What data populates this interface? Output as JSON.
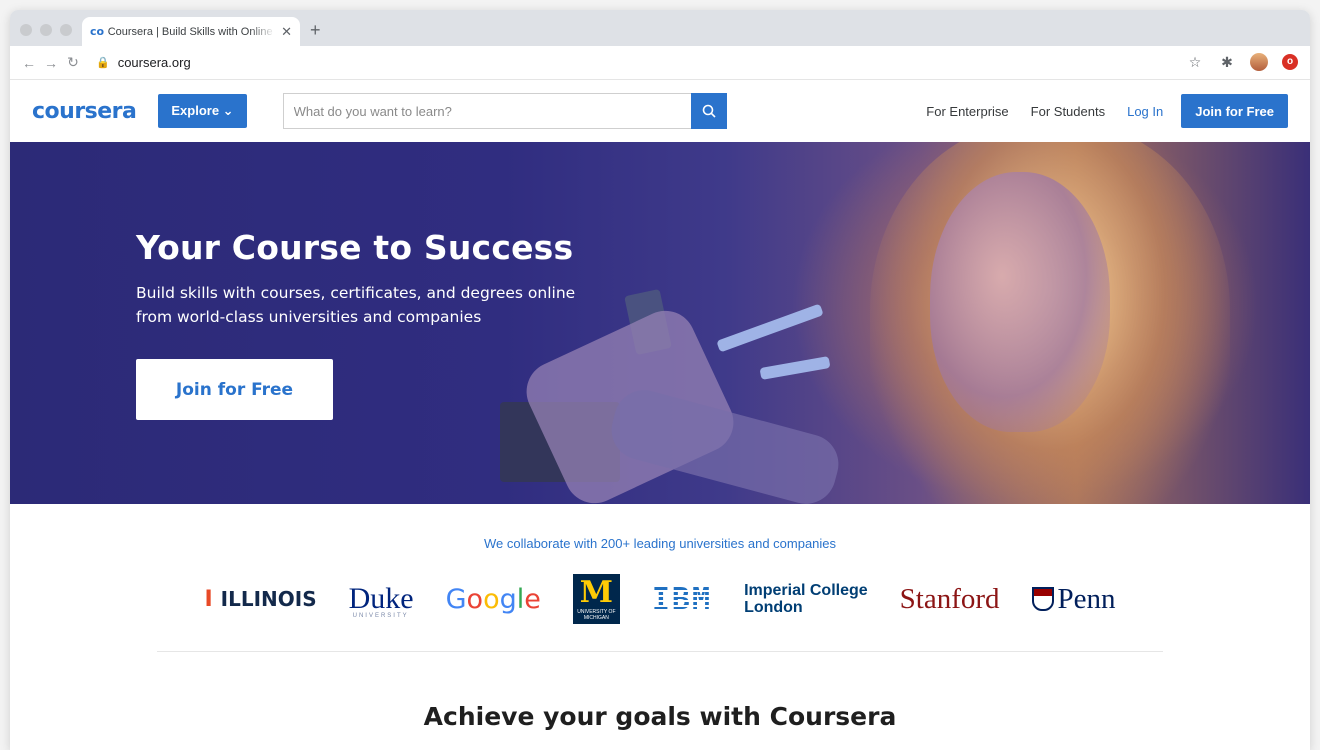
{
  "browser": {
    "tab_title": "Coursera | Build Skills with Online Courses",
    "tab_favicon": "co",
    "url": "coursera.org"
  },
  "header": {
    "logo": "coursera",
    "explore": "Explore ⌄",
    "search_placeholder": "What do you want to learn?",
    "nav": {
      "enterprise": "For Enterprise",
      "students": "For Students",
      "login": "Log In",
      "join": "Join for Free"
    }
  },
  "hero": {
    "title": "Your Course to Success",
    "subtitle": "Build skills with courses, certificates, and degrees online from world-class universities and companies",
    "cta": "Join for Free"
  },
  "partners": {
    "caption": "We collaborate with 200+ leading universities and companies",
    "illinois": "ILLINOIS",
    "duke": "Duke",
    "duke_sub": "UNIVERSITY",
    "google": [
      "G",
      "o",
      "o",
      "g",
      "l",
      "e"
    ],
    "michigan": "M",
    "michigan_sub": "UNIVERSITY OF MICHIGAN",
    "ibm": "IBM",
    "imperial_line1": "Imperial College",
    "imperial_line2": "London",
    "stanford": "Stanford",
    "penn": "Penn"
  },
  "goals_title": "Achieve your goals with Coursera",
  "colors": {
    "brand_blue": "#2a73cc",
    "hero_bg": "#2c2a77"
  }
}
